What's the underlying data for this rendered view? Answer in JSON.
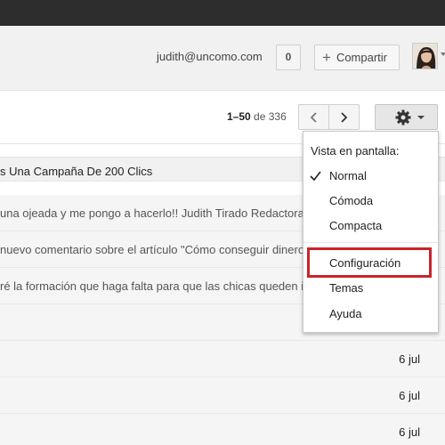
{
  "account": {
    "email": "judith@uncomo.com",
    "notification_count": "0",
    "share_label": "Compartir"
  },
  "toolbar": {
    "pager_range": "1–50",
    "pager_of": "de",
    "pager_total": "336"
  },
  "settings_menu": {
    "header": "Vista en pantalla:",
    "density_options": [
      {
        "label": "Normal",
        "checked": true
      },
      {
        "label": "Cómoda",
        "checked": false
      },
      {
        "label": "Compacta",
        "checked": false
      }
    ],
    "items": [
      {
        "label": "Configuración",
        "highlighted": true
      },
      {
        "label": "Temas"
      },
      {
        "label": "Ayuda"
      }
    ],
    "highlight_color": "#c8242c"
  },
  "mail_rows": [
    {
      "snippet": "s Una Campaña De 200 Clics",
      "date": ""
    },
    {
      "snippet": "una ojeada y me pongo a hacerlo!! Judith Tirado Redactora",
      "date": ""
    },
    {
      "snippet": "nuevo comentario sobre el artículo \"Cómo conseguir dinero",
      "date": ""
    },
    {
      "snippet": "ré la formación que haga falta para que las chicas queden i",
      "date": ""
    },
    {
      "snippet": "",
      "date": ""
    },
    {
      "snippet": "",
      "date": "6 jul"
    },
    {
      "snippet": "",
      "date": "6 jul"
    },
    {
      "snippet": "",
      "date": "6 jul"
    }
  ]
}
